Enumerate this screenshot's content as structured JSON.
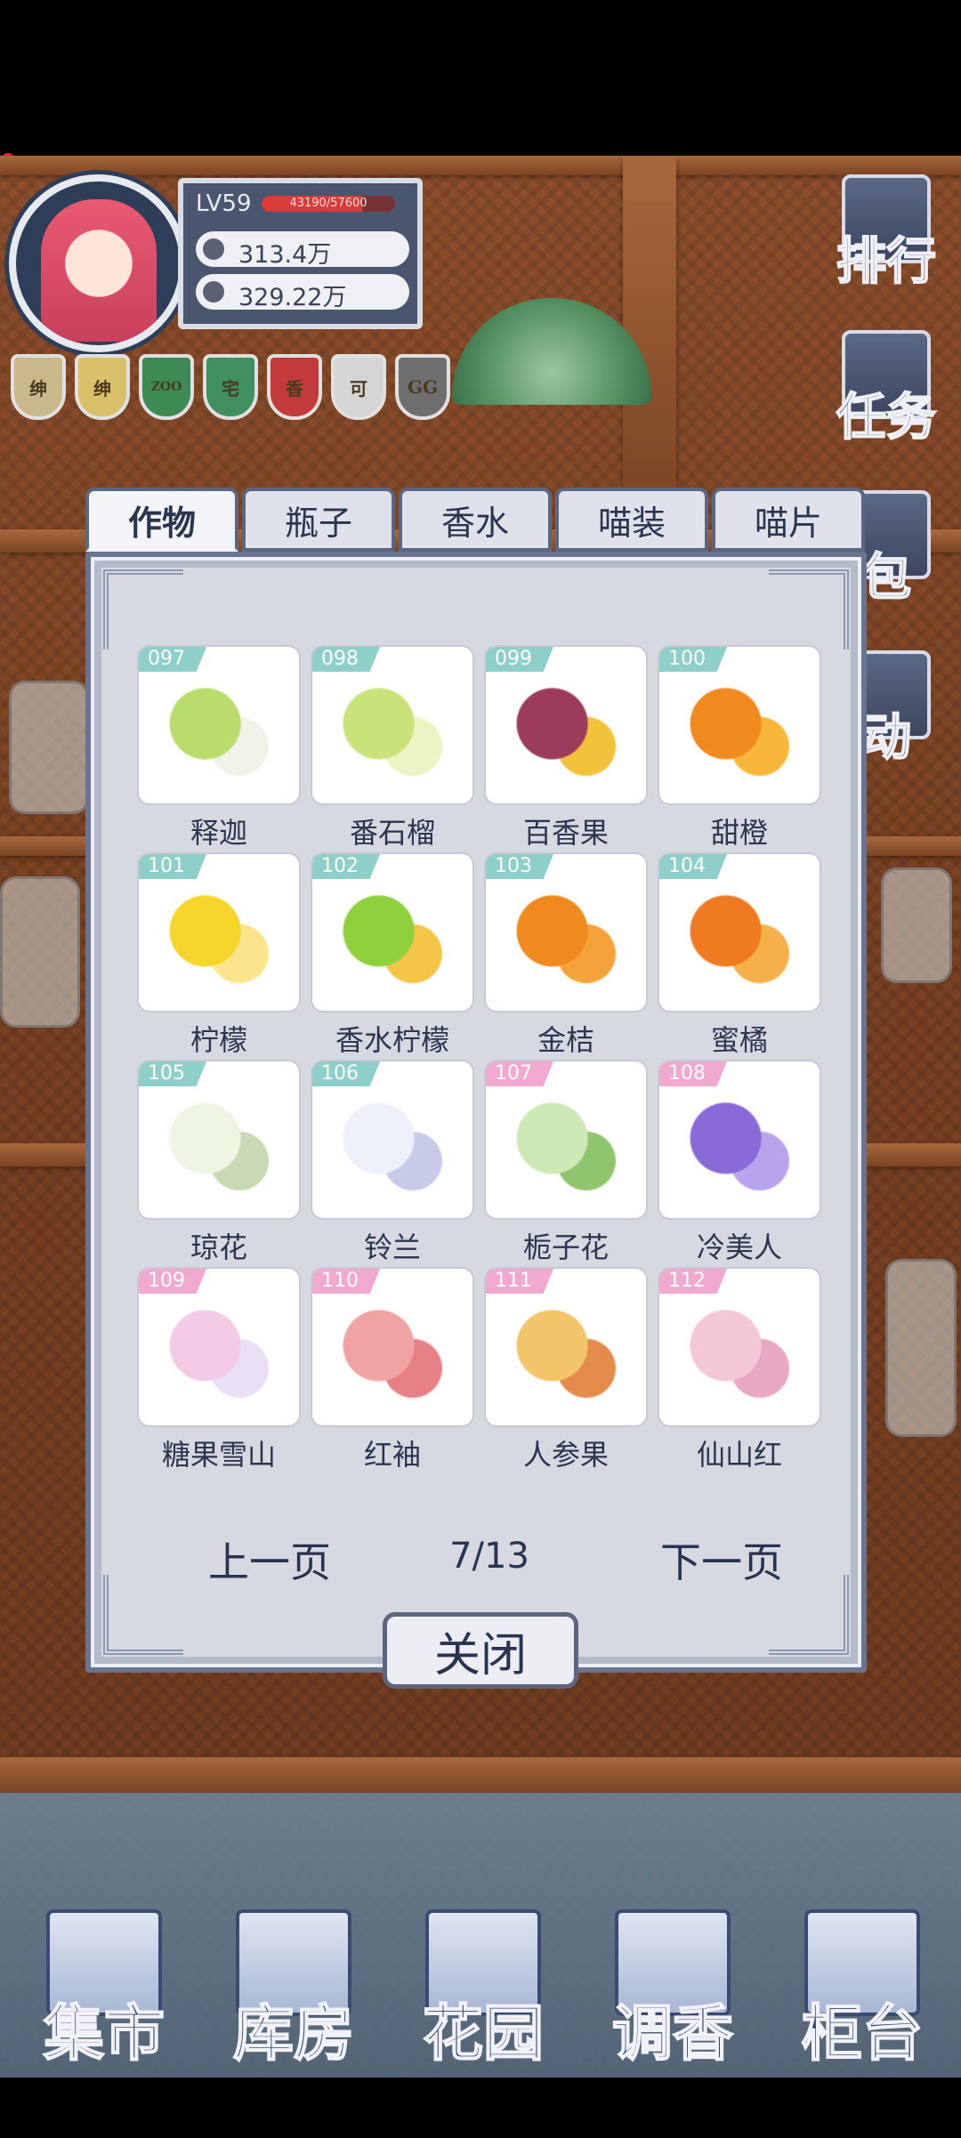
{
  "player": {
    "level": "LV59",
    "exp_text": "43190/57600",
    "exp_fraction": 0.75,
    "currency_1": "313.4万",
    "currency_2": "329.22万"
  },
  "badges": [
    {
      "label": "绅",
      "color": "#c9b98a"
    },
    {
      "label": "绅",
      "color": "#d9c06a"
    },
    {
      "label": "ZOO",
      "color": "#3d8a55"
    },
    {
      "label": "宅",
      "color": "#3f8f60"
    },
    {
      "label": "香",
      "color": "#c23a3a"
    },
    {
      "label": "可",
      "color": "#d5d5d5"
    },
    {
      "label": "GG",
      "color": "#6f6f6f"
    }
  ],
  "side_menu": [
    {
      "label": "排行",
      "icon": "ranking-icon"
    },
    {
      "label": "任务",
      "icon": "task-icon"
    },
    {
      "label": "包",
      "icon": "bag-icon"
    },
    {
      "label": "动",
      "icon": "activity-icon"
    }
  ],
  "tabs": [
    {
      "label": "作物",
      "active": true
    },
    {
      "label": "瓶子",
      "active": false
    },
    {
      "label": "香水",
      "active": false
    },
    {
      "label": "喵装",
      "active": false
    },
    {
      "label": "喵片",
      "active": false
    }
  ],
  "items": [
    {
      "id": "097",
      "name": "释迦",
      "tag_color": "#8fcfc9",
      "icon": "sugar-apple-icon",
      "c1": "#b9dc6a",
      "c2": "#f1f3e8"
    },
    {
      "id": "098",
      "name": "番石榴",
      "tag_color": "#8fcfc9",
      "icon": "guava-icon",
      "c1": "#c9e27a",
      "c2": "#eef3c4"
    },
    {
      "id": "099",
      "name": "百香果",
      "tag_color": "#8fcfc9",
      "icon": "passion-fruit-icon",
      "c1": "#9c3c5a",
      "c2": "#f2c23a"
    },
    {
      "id": "100",
      "name": "甜橙",
      "tag_color": "#8fcfc9",
      "icon": "sweet-orange-icon",
      "c1": "#f08a1e",
      "c2": "#f8b73a"
    },
    {
      "id": "101",
      "name": "柠檬",
      "tag_color": "#8fcfc9",
      "icon": "lemon-icon",
      "c1": "#f5d52a",
      "c2": "#fae58c"
    },
    {
      "id": "102",
      "name": "香水柠檬",
      "tag_color": "#8fcfc9",
      "icon": "perfume-lemon-icon",
      "c1": "#8fd13d",
      "c2": "#f5c54a"
    },
    {
      "id": "103",
      "name": "金桔",
      "tag_color": "#8fcfc9",
      "icon": "kumquat-icon",
      "c1": "#f08a1e",
      "c2": "#f6a23a"
    },
    {
      "id": "104",
      "name": "蜜橘",
      "tag_color": "#8fcfc9",
      "icon": "mandarin-icon",
      "c1": "#ef7a22",
      "c2": "#f6b04a"
    },
    {
      "id": "105",
      "name": "琼花",
      "tag_color": "#8fcfc9",
      "icon": "viburnum-flower-icon",
      "c1": "#eef5e2",
      "c2": "#c9d9b4"
    },
    {
      "id": "106",
      "name": "铃兰",
      "tag_color": "#8fcfc9",
      "icon": "lily-of-the-valley-icon",
      "c1": "#eef0fb",
      "c2": "#c7cbe9"
    },
    {
      "id": "107",
      "name": "栀子花",
      "tag_color": "#f2a9cf",
      "icon": "gardenia-icon",
      "c1": "#cfe9b6",
      "c2": "#8fc56e"
    },
    {
      "id": "108",
      "name": "冷美人",
      "tag_color": "#f2a9cf",
      "icon": "purple-rose-icon",
      "c1": "#8a6ad9",
      "c2": "#b9a3ec"
    },
    {
      "id": "109",
      "name": "糖果雪山",
      "tag_color": "#f2a9cf",
      "icon": "candy-rose-icon",
      "c1": "#f4cbe6",
      "c2": "#e9e0f5"
    },
    {
      "id": "110",
      "name": "红袖",
      "tag_color": "#f2a9cf",
      "icon": "red-rose-icon",
      "c1": "#f0a3a3",
      "c2": "#e77f86"
    },
    {
      "id": "111",
      "name": "人参果",
      "tag_color": "#f2a9cf",
      "icon": "pepino-melon-icon",
      "c1": "#f3c46a",
      "c2": "#e48a4a"
    },
    {
      "id": "112",
      "name": "仙山红",
      "tag_color": "#f2a9cf",
      "icon": "orchid-icon",
      "c1": "#f3c7d8",
      "c2": "#e8a7c2"
    }
  ],
  "pager": {
    "prev": "上一页",
    "page": "7/13",
    "next": "下一页"
  },
  "close_label": "关闭",
  "bottom_nav": [
    {
      "label": "集市",
      "icon": "market-icon"
    },
    {
      "label": "库房",
      "icon": "warehouse-icon"
    },
    {
      "label": "花园",
      "icon": "garden-icon"
    },
    {
      "label": "调香",
      "icon": "perfume-mixing-icon"
    },
    {
      "label": "柜台",
      "icon": "counter-icon"
    }
  ]
}
